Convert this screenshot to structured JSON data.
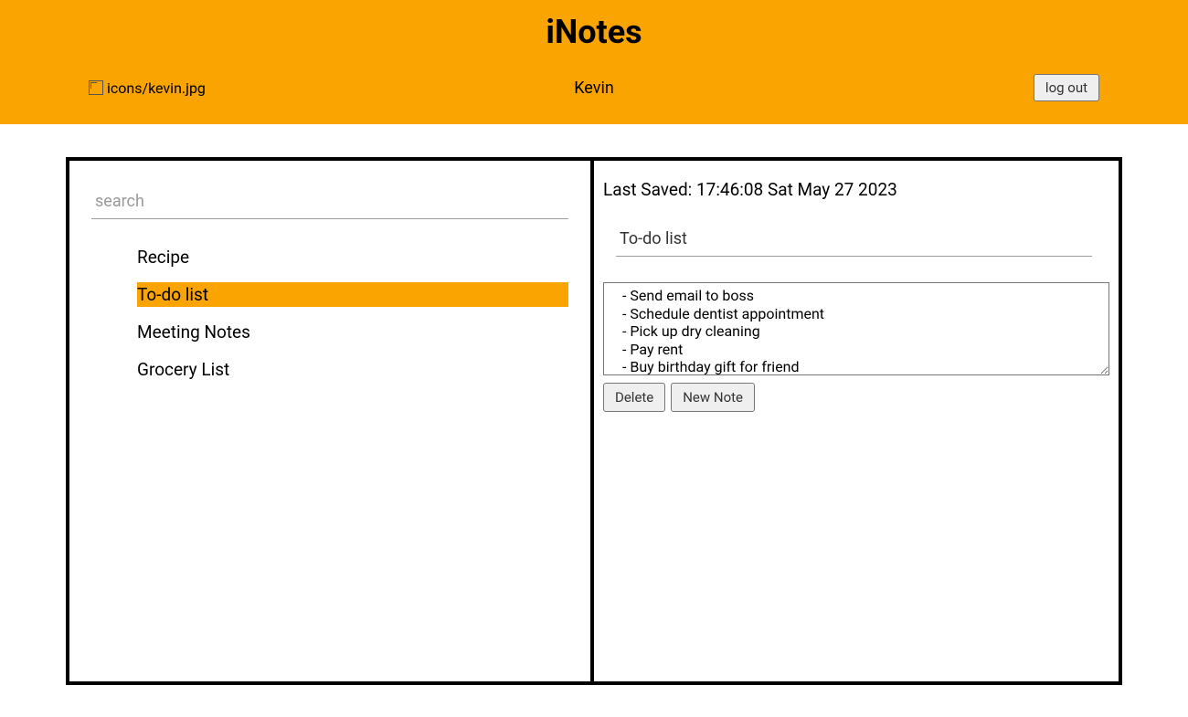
{
  "header": {
    "app_title": "iNotes",
    "avatar_alt": "icons/kevin.jpg",
    "user_name": "Kevin",
    "logout_label": "log out"
  },
  "sidebar": {
    "search_placeholder": "search",
    "notes": [
      {
        "title": "Recipe",
        "active": false
      },
      {
        "title": "To-do list",
        "active": true
      },
      {
        "title": "Meeting Notes",
        "active": false
      },
      {
        "title": "Grocery List",
        "active": false
      }
    ]
  },
  "detail": {
    "last_saved_label": "Last Saved: 17:46:08 Sat May 27 2023",
    "title_value": "To-do list",
    "body_value": "- Send email to boss\n- Schedule dentist appointment\n- Pick up dry cleaning\n- Pay rent\n- Buy birthday gift for friend",
    "delete_label": "Delete",
    "new_note_label": "New Note"
  }
}
